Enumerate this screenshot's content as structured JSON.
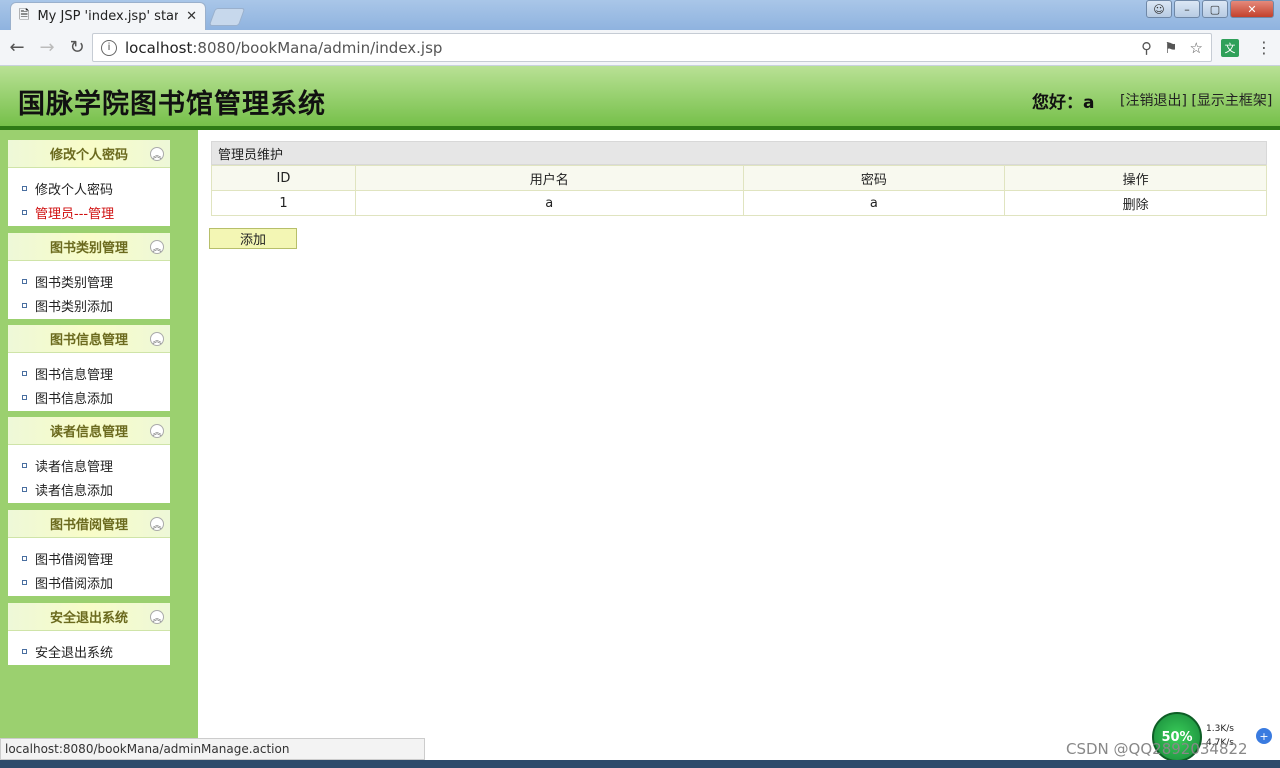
{
  "browser": {
    "tab_title": "My JSP 'index.jsp' starti",
    "url_host": "localhost",
    "url_rest": ":8080/bookMana/admin/index.jsp",
    "status_url": "localhost:8080/bookMana/adminManage.action",
    "extension_label": "文"
  },
  "header": {
    "title": "国脉学院图书馆管理系统",
    "greeting": "您好：a",
    "logout_link": "[注销退出]",
    "show_frame_link": "[显示主框架]"
  },
  "sidebar": {
    "panels": [
      {
        "title": "修改个人密码",
        "items": [
          "修改个人密码",
          "管理员---管理"
        ]
      },
      {
        "title": "图书类别管理",
        "items": [
          "图书类别管理",
          "图书类别添加"
        ]
      },
      {
        "title": "图书信息管理",
        "items": [
          "图书信息管理",
          "图书信息添加"
        ]
      },
      {
        "title": "读者信息管理",
        "items": [
          "读者信息管理",
          "读者信息添加"
        ]
      },
      {
        "title": "图书借阅管理",
        "items": [
          "图书借阅管理",
          "图书借阅添加"
        ]
      },
      {
        "title": "安全退出系统",
        "items": [
          "安全退出系统"
        ]
      }
    ],
    "active_item": "管理员---管理"
  },
  "main": {
    "caption": "管理员维护",
    "columns": [
      "ID",
      "用户名",
      "密码",
      "操作"
    ],
    "rows": [
      {
        "id": "1",
        "username": "a",
        "password": "a",
        "action": "删除"
      }
    ],
    "add_button": "添加"
  },
  "tray": {
    "net_percent": "50%",
    "up_speed": "1.3K/s",
    "down_speed": "4.7K/s",
    "watermark": "CSDN @QQ2892034822"
  },
  "colors": {
    "header_green": "#76c04a",
    "header_border": "#2e7a16",
    "sidebar_bg": "#9bd06f",
    "active_item": "#d01010"
  }
}
